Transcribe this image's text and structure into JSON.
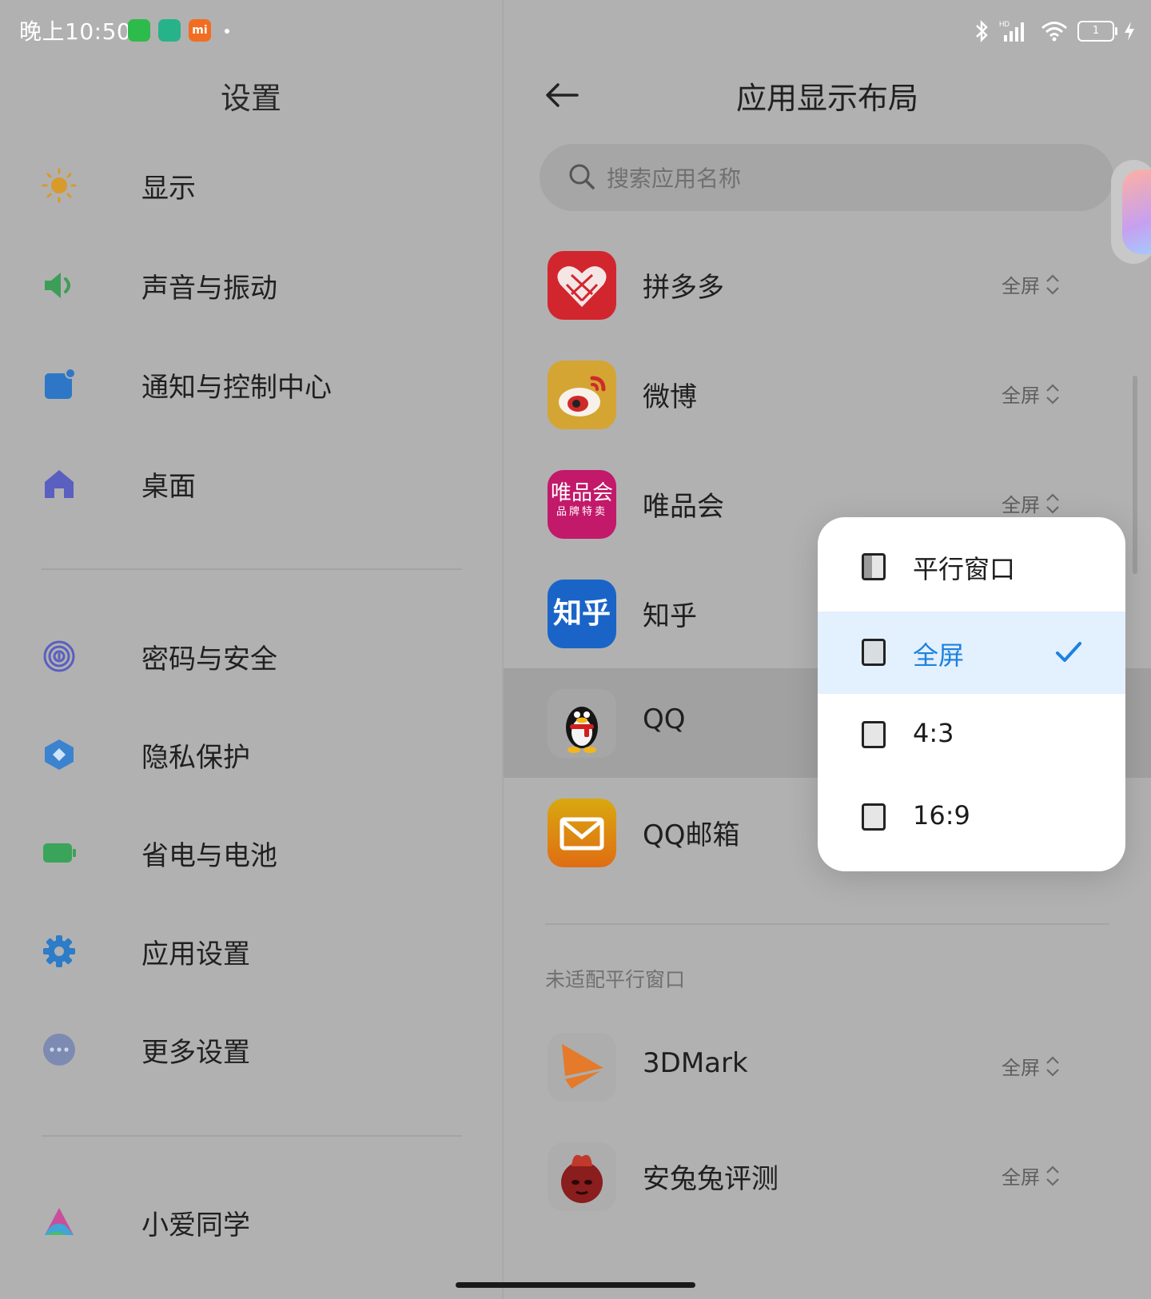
{
  "status_bar": {
    "time": "晚上10:50",
    "mi_label": "mi",
    "battery": "1"
  },
  "left_pane": {
    "title": "设置",
    "items": [
      {
        "label": "显示",
        "icon": "sun-icon"
      },
      {
        "label": "声音与振动",
        "icon": "speaker-icon"
      },
      {
        "label": "通知与控制中心",
        "icon": "notification-icon"
      },
      {
        "label": "桌面",
        "icon": "home-icon"
      },
      {
        "label": "密码与安全",
        "icon": "fingerprint-icon"
      },
      {
        "label": "隐私保护",
        "icon": "privacy-icon"
      },
      {
        "label": "省电与电池",
        "icon": "battery-icon"
      },
      {
        "label": "应用设置",
        "icon": "gear-icon"
      },
      {
        "label": "更多设置",
        "icon": "more-icon"
      },
      {
        "label": "小爱同学",
        "icon": "xiaoai-icon"
      }
    ]
  },
  "right_pane": {
    "title": "应用显示布局",
    "search_placeholder": "搜索应用名称",
    "apps": [
      {
        "name": "拼多多",
        "mode": "全屏"
      },
      {
        "name": "微博",
        "mode": "全屏"
      },
      {
        "name": "唯品会",
        "mode": "全屏",
        "icon_text_1": "唯品会",
        "icon_text_2": "品牌特卖"
      },
      {
        "name": "知乎",
        "icon_text": "知乎"
      },
      {
        "name": "QQ"
      },
      {
        "name": "QQ邮箱"
      }
    ],
    "section_label": "未适配平行窗口",
    "apps2": [
      {
        "name": "3DMark",
        "mode": "全屏"
      },
      {
        "name": "安兔兔评测",
        "mode": "全屏"
      }
    ]
  },
  "popup": {
    "options": [
      {
        "label": "平行窗口",
        "selected": false
      },
      {
        "label": "全屏",
        "selected": true
      },
      {
        "label": "4:3",
        "selected": false
      },
      {
        "label": "16:9",
        "selected": false
      }
    ]
  },
  "colors": {
    "accent": "#1c82e0",
    "overlay_bg": "#b1b1b1"
  }
}
